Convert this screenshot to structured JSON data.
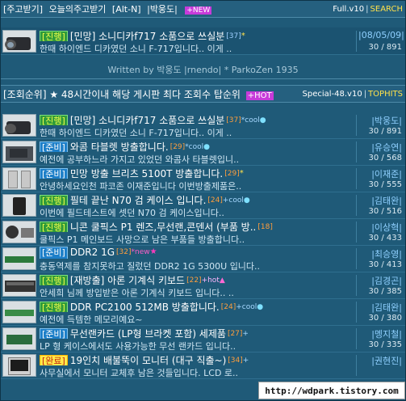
{
  "header": {
    "tabs": [
      "[주고받기]",
      "오늘의주고받기",
      "[Alt-N]",
      "|박웅도|"
    ],
    "new_badge": "+NEW",
    "version": "Full.v10",
    "search_label": "SEARCH"
  },
  "latest": {
    "tag": "[진행]",
    "title": "[민망] 소니디카f717 소품으로 쓰실분",
    "count": "[37]",
    "star": "*",
    "body": "한때 하이엔드 디카였던 소니 F-717입니다.. 이게 ..",
    "date": "|08/05/09|",
    "views": "30 / 891"
  },
  "writer_line": "Written by 박웅도 |rnendo| * ParkoZen 1935",
  "ranking_header": {
    "label": "[조회순위] ★ 48시간이내 해당 게시판 최다 조회수 탑순위",
    "hot_badge": "+HOT",
    "version": "Special-48.v10",
    "tophits_label": "TOPHITS"
  },
  "items": [
    {
      "tag": "[진행]",
      "tag_color": "green",
      "title": "[민망] 소니디카f717 소품으로 쓰실분",
      "count": "[37]",
      "extra": "*cool",
      "extra_type": "cool",
      "body": "한때 하이엔드 디카였던 소니 F-717입니다.. 이게 ..",
      "author": "|박웅도|",
      "views": "30 / 891"
    },
    {
      "tag": "[준비]",
      "tag_color": "blue",
      "title": "와콤 타블렛 방출합니다.",
      "count": "[29]",
      "extra": "*cool",
      "extra_type": "cool",
      "body": "예전에 공부하느라 가지고 있었던 와콤사 타블렛입니..",
      "author": "|유승연|",
      "views": "30 / 568"
    },
    {
      "tag": "[준비]",
      "tag_color": "blue",
      "title": "민망 방출 브리츠 5100T 방출합니다.",
      "count": "[29]",
      "extra": "*",
      "extra_type": "star",
      "body": "안녕하세요인천 파코존 이재준입니다 이번방출제품은..",
      "author": "|이재준|",
      "views": "30 / 555"
    },
    {
      "tag": "[진행]",
      "tag_color": "green",
      "title": "필테 끝난 N70 검 케이스 입니다.",
      "count": "[24]",
      "extra": "+cool",
      "extra_type": "cool",
      "body": "이번에 필드테스트에 셋던 N70 검 케이스입니다..",
      "author": "|김태완|",
      "views": "30 / 516"
    },
    {
      "tag": "[진행]",
      "tag_color": "green",
      "title": "니콘 쿨픽스 P1 렌즈,무선랜,콘덴서 (부품 방..",
      "count": "[18]",
      "extra": "",
      "extra_type": "none",
      "body": "쿨픽스 P1 메인보드 사망으로 남은 부품들 방출합니다..",
      "author": "|이상혁|",
      "views": "30 / 433"
    },
    {
      "tag": "[준비]",
      "tag_color": "blue",
      "title": "DDR2 1G",
      "count": "[32]",
      "extra": "*new",
      "extra_type": "new",
      "body": "충동역제를 참지못하고 질렀던 DDR2 1G 5300U 입니다..",
      "author": "|최승영|",
      "views": "30 / 413"
    },
    {
      "tag": "[진행]",
      "tag_color": "green",
      "title": "[재방출] 아론 기계식 키보드",
      "count": "[22]",
      "extra": "+hot",
      "extra_type": "hot",
      "body": "안세희 님께 방입받은 아론 기계식 키보드 입니다.. ..",
      "author": "|김경곤|",
      "views": "30 / 385"
    },
    {
      "tag": "[진행]",
      "tag_color": "green",
      "title": "DDR PC2100 512MB 방출합니다.",
      "count": "[24]",
      "extra": "+cool",
      "extra_type": "cool",
      "body": "예전에 득템한 메모리예요~",
      "author": "|김태완|",
      "views": "30 / 380"
    },
    {
      "tag": "[준비]",
      "tag_color": "blue",
      "title": "무선랜카드 (LP형 브라켓 포함) 세제품",
      "count": "[27]",
      "extra": "+",
      "extra_type": "plus",
      "body": "LP 형 케이스에서도 사용가능한 무선 랜카드 입니다..",
      "author": "|멩지철|",
      "views": "30 / 335"
    },
    {
      "tag": "[완료]",
      "tag_color": "yellow",
      "title": "19인치 배불뚝이 모니터 (대구 직출~)",
      "count": "[34]",
      "extra": "+",
      "extra_type": "plus",
      "body": "사무실에서 모니터 교체후 남은 것들입니다. LCD 로..",
      "author": "|권현진|",
      "views": ""
    }
  ],
  "watermark": "http://wdpark.tistory.com"
}
